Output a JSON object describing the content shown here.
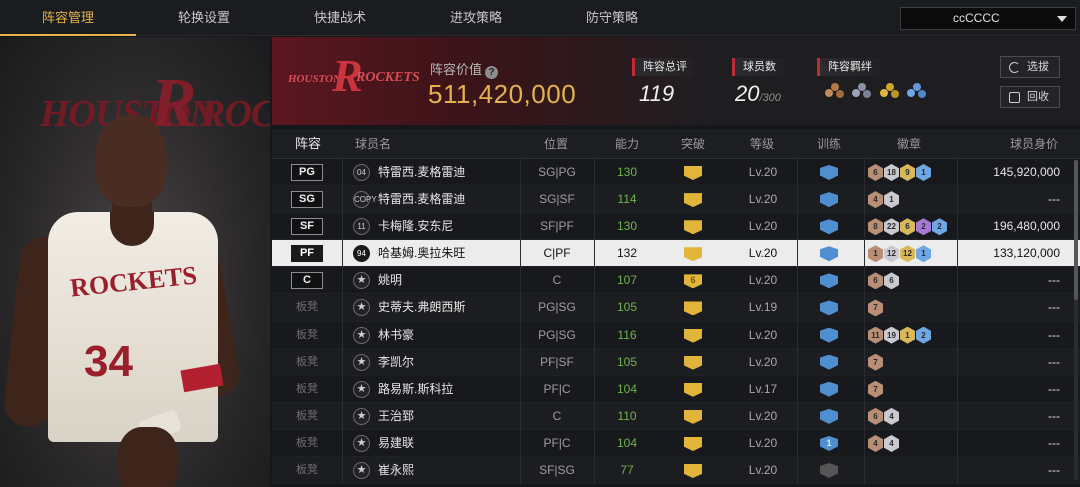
{
  "nav": {
    "tabs": [
      "阵容管理",
      "轮换设置",
      "快捷战术",
      "进攻策略",
      "防守策略"
    ],
    "active_tab": 0,
    "team_select": "ccCCCC"
  },
  "player_panel": {
    "bg_logo_left": "HOUSTON",
    "bg_logo_big": "R",
    "bg_logo_right": "ROCK",
    "jersey_text": "ROCKETS",
    "jersey_number": "34"
  },
  "header": {
    "logo_r": "R",
    "logo_left": "HOUSTON",
    "logo_right": "ROCKETS",
    "value_label": "阵容价值",
    "value": "511,420,000",
    "rating_label": "阵容总评",
    "rating": "119",
    "count_label": "球员数",
    "count": "20",
    "count_max": "/300",
    "chem_label": "阵容羁绊",
    "scout_button": "选拔",
    "recycle_button": "回收"
  },
  "table": {
    "headers": {
      "lineup": "阵容",
      "name": "球员名",
      "position": "位置",
      "rating": "能力",
      "breakthrough": "突破",
      "level": "等级",
      "training": "训练",
      "badges": "徽章",
      "value": "球员身价"
    },
    "rows": [
      {
        "slot": "PG",
        "bench": false,
        "num": "04",
        "name": "特雷西.麦格雷迪",
        "pos": "SG|PG",
        "rating": "130",
        "brk": "",
        "lvl": "Lv.20",
        "train": "",
        "badges": [
          [
            "bronze",
            "6"
          ],
          [
            "silver",
            "18"
          ],
          [
            "gold",
            "9"
          ],
          [
            "blue",
            "1"
          ]
        ],
        "value": "145,920,000",
        "selected": false
      },
      {
        "slot": "SG",
        "bench": false,
        "num": "COPY",
        "name": "特雷西.麦格雷迪",
        "pos": "SG|SF",
        "rating": "114",
        "brk": "",
        "lvl": "Lv.20",
        "train": "",
        "badges": [
          [
            "bronze",
            "4"
          ],
          [
            "silver",
            "1"
          ]
        ],
        "value": "---",
        "selected": false
      },
      {
        "slot": "SF",
        "bench": false,
        "num": "11",
        "name": "卡梅隆.安东尼",
        "pos": "SF|PF",
        "rating": "130",
        "brk": "",
        "lvl": "Lv.20",
        "train": "",
        "badges": [
          [
            "bronze",
            "8"
          ],
          [
            "silver",
            "22"
          ],
          [
            "gold",
            "6"
          ],
          [
            "purple",
            "2"
          ],
          [
            "blue",
            "2"
          ]
        ],
        "value": "196,480,000",
        "selected": false
      },
      {
        "slot": "PF",
        "bench": false,
        "num": "94",
        "name": "哈基姆.奥拉朱旺",
        "pos": "C|PF",
        "rating": "132",
        "brk": "",
        "lvl": "Lv.20",
        "train": "",
        "badges": [
          [
            "bronze",
            "1"
          ],
          [
            "silver",
            "12"
          ],
          [
            "gold",
            "12"
          ],
          [
            "blue",
            "1"
          ]
        ],
        "value": "133,120,000",
        "selected": true
      },
      {
        "slot": "C",
        "bench": false,
        "num": "★",
        "name": "姚明",
        "pos": "C",
        "rating": "107",
        "brk": "6",
        "lvl": "Lv.20",
        "train": "",
        "badges": [
          [
            "bronze",
            "6"
          ],
          [
            "silver",
            "6"
          ]
        ],
        "value": "---",
        "selected": false
      },
      {
        "slot": "板凳",
        "bench": true,
        "num": "★",
        "name": "史蒂夫.弗朗西斯",
        "pos": "PG|SG",
        "rating": "105",
        "brk": "",
        "lvl": "Lv.19",
        "train": "",
        "badges": [
          [
            "bronze",
            "7"
          ]
        ],
        "value": "---",
        "selected": false
      },
      {
        "slot": "板凳",
        "bench": true,
        "num": "★",
        "name": "林书豪",
        "pos": "PG|SG",
        "rating": "116",
        "brk": "",
        "lvl": "Lv.20",
        "train": "",
        "badges": [
          [
            "bronze",
            "11"
          ],
          [
            "silver",
            "19"
          ],
          [
            "gold",
            "1"
          ],
          [
            "blue",
            "2"
          ]
        ],
        "value": "---",
        "selected": false
      },
      {
        "slot": "板凳",
        "bench": true,
        "num": "★",
        "name": "李凯尔",
        "pos": "PF|SF",
        "rating": "105",
        "brk": "",
        "lvl": "Lv.20",
        "train": "",
        "badges": [
          [
            "bronze",
            "7"
          ]
        ],
        "value": "---",
        "selected": false
      },
      {
        "slot": "板凳",
        "bench": true,
        "num": "★",
        "name": "路易斯.斯科拉",
        "pos": "PF|C",
        "rating": "104",
        "brk": "",
        "lvl": "Lv.17",
        "train": "",
        "badges": [
          [
            "bronze",
            "7"
          ]
        ],
        "value": "---",
        "selected": false
      },
      {
        "slot": "板凳",
        "bench": true,
        "num": "★",
        "name": "王治郅",
        "pos": "C",
        "rating": "110",
        "brk": "",
        "lvl": "Lv.20",
        "train": "",
        "badges": [
          [
            "bronze",
            "6"
          ],
          [
            "silver",
            "4"
          ]
        ],
        "value": "---",
        "selected": false
      },
      {
        "slot": "板凳",
        "bench": true,
        "num": "★",
        "name": "易建联",
        "pos": "PF|C",
        "rating": "104",
        "brk": "",
        "lvl": "Lv.20",
        "train": "1",
        "badges": [
          [
            "bronze",
            "4"
          ],
          [
            "silver",
            "4"
          ]
        ],
        "value": "---",
        "selected": false
      },
      {
        "slot": "板凳",
        "bench": true,
        "num": "★",
        "name": "崔永熙",
        "pos": "SF|SG",
        "rating": "77",
        "brk": "",
        "lvl": "Lv.20",
        "train": "grey",
        "badges": [],
        "value": "---",
        "selected": false
      }
    ]
  }
}
